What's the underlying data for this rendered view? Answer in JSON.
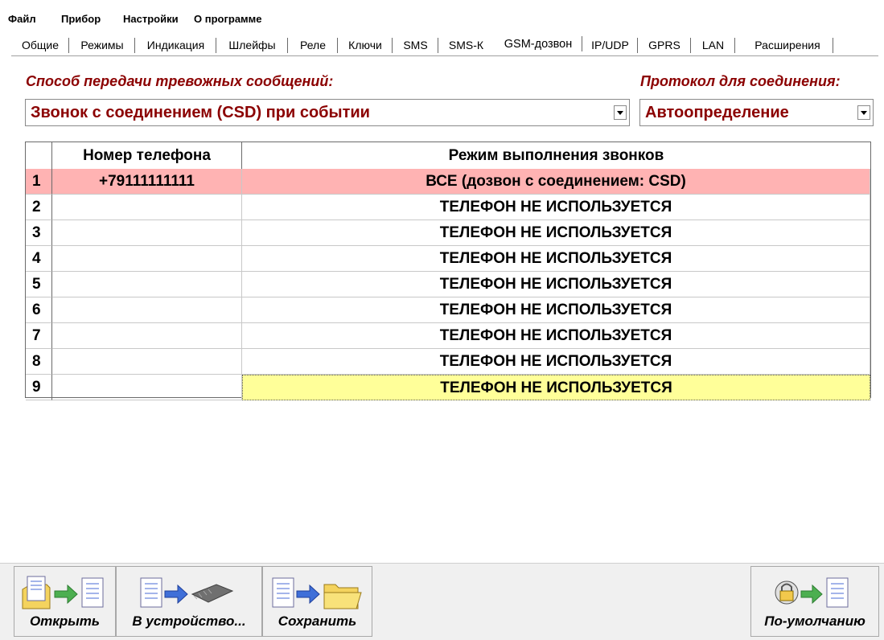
{
  "menu": [
    "Файл",
    "Прибор",
    "Настройки",
    "О программе"
  ],
  "tabs": [
    {
      "label": "Общие",
      "active": false
    },
    {
      "label": "Режимы",
      "active": false
    },
    {
      "label": "Индикация",
      "active": false
    },
    {
      "label": "Шлейфы",
      "active": false
    },
    {
      "label": "Реле",
      "active": false
    },
    {
      "label": "Ключи",
      "active": false
    },
    {
      "label": "SMS",
      "active": false
    },
    {
      "label": "SMS-К",
      "active": false
    },
    {
      "label": "GSM-дозвон",
      "active": true
    },
    {
      "label": "IP/UDP",
      "active": false
    },
    {
      "label": "GPRS",
      "active": false
    },
    {
      "label": "LAN",
      "active": false
    },
    {
      "label": "Расширения",
      "active": false
    }
  ],
  "transfer": {
    "label": "Способ передачи тревожных сообщений:",
    "value": "Звонок с соединением (CSD) при событии"
  },
  "protocol": {
    "label": "Протокол для соединения:",
    "value": "Автоопределение"
  },
  "grid": {
    "headers": [
      "",
      "Номер телефона",
      "Режим выполнения звонков"
    ],
    "rows": [
      {
        "num": "1",
        "phone": "+79111111111",
        "mode": "ВСЕ (дозвон с соединением: CSD)"
      },
      {
        "num": "2",
        "phone": "",
        "mode": "ТЕЛЕФОН НЕ ИСПОЛЬЗУЕТСЯ"
      },
      {
        "num": "3",
        "phone": "",
        "mode": "ТЕЛЕФОН НЕ ИСПОЛЬЗУЕТСЯ"
      },
      {
        "num": "4",
        "phone": "",
        "mode": "ТЕЛЕФОН НЕ ИСПОЛЬЗУЕТСЯ"
      },
      {
        "num": "5",
        "phone": "",
        "mode": "ТЕЛЕФОН НЕ ИСПОЛЬЗУЕТСЯ"
      },
      {
        "num": "6",
        "phone": "",
        "mode": "ТЕЛЕФОН НЕ ИСПОЛЬЗУЕТСЯ"
      },
      {
        "num": "7",
        "phone": "",
        "mode": "ТЕЛЕФОН НЕ ИСПОЛЬЗУЕТСЯ"
      },
      {
        "num": "8",
        "phone": "",
        "mode": "ТЕЛЕФОН НЕ ИСПОЛЬЗУЕТСЯ"
      },
      {
        "num": "9",
        "phone": "",
        "mode": "ТЕЛЕФОН НЕ ИСПОЛЬЗУЕТСЯ"
      }
    ]
  },
  "toolbar": {
    "open": "Открыть",
    "to_device": "В устройство...",
    "save": "Сохранить",
    "defaults": "По-умолчанию"
  },
  "colors": {
    "label_red": "#8b0000",
    "selected_row": "#ffb3b3",
    "focus_cell": "#ffff99"
  }
}
